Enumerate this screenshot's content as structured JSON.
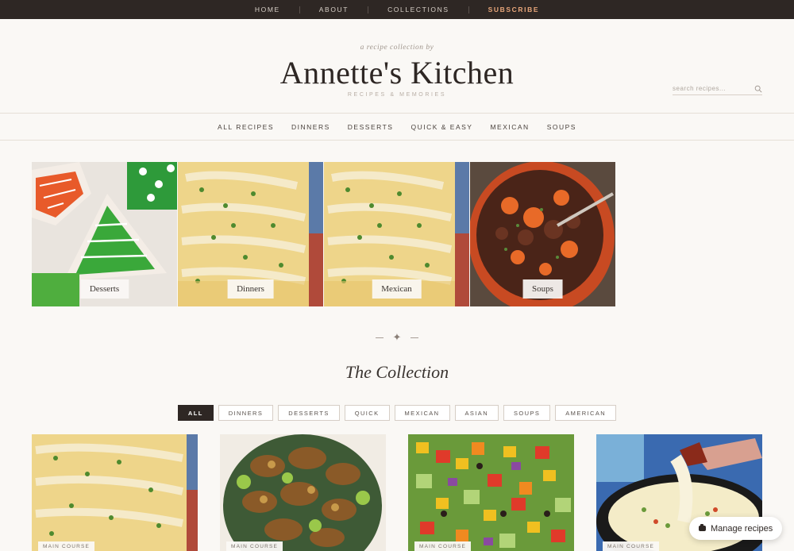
{
  "topnav": [
    {
      "label": "HOME"
    },
    {
      "label": "ABOUT"
    },
    {
      "label": "COLLECTIONS"
    },
    {
      "label": "SUBSCRIBE"
    }
  ],
  "header": {
    "tagline": "a recipe collection by",
    "title": "Annette's Kitchen",
    "subtitle": "RECIPES & MEMORIES",
    "search_placeholder": "search recipes..."
  },
  "category_nav": [
    "ALL RECIPES",
    "DINNERS",
    "DESSERTS",
    "QUICK & EASY",
    "MEXICAN",
    "SOUPS"
  ],
  "category_tiles": [
    {
      "label": "Desserts"
    },
    {
      "label": "Dinners"
    },
    {
      "label": "Mexican"
    },
    {
      "label": "Soups"
    }
  ],
  "collection": {
    "title": "The Collection",
    "filters": [
      "ALL",
      "DINNERS",
      "DESSERTS",
      "QUICK",
      "MEXICAN",
      "ASIAN",
      "SOUPS",
      "AMERICAN"
    ],
    "active_filter": "ALL"
  },
  "recipe_cards": [
    {
      "badge": "MAIN COURSE"
    },
    {
      "badge": "MAIN COURSE"
    },
    {
      "badge": "MAIN COURSE"
    },
    {
      "badge": "MAIN COURSE"
    }
  ],
  "manage_button": {
    "label": "Manage recipes"
  },
  "colors": {
    "dark": "#2e2724",
    "accent": "#e8a67a",
    "background": "#faf8f5"
  }
}
